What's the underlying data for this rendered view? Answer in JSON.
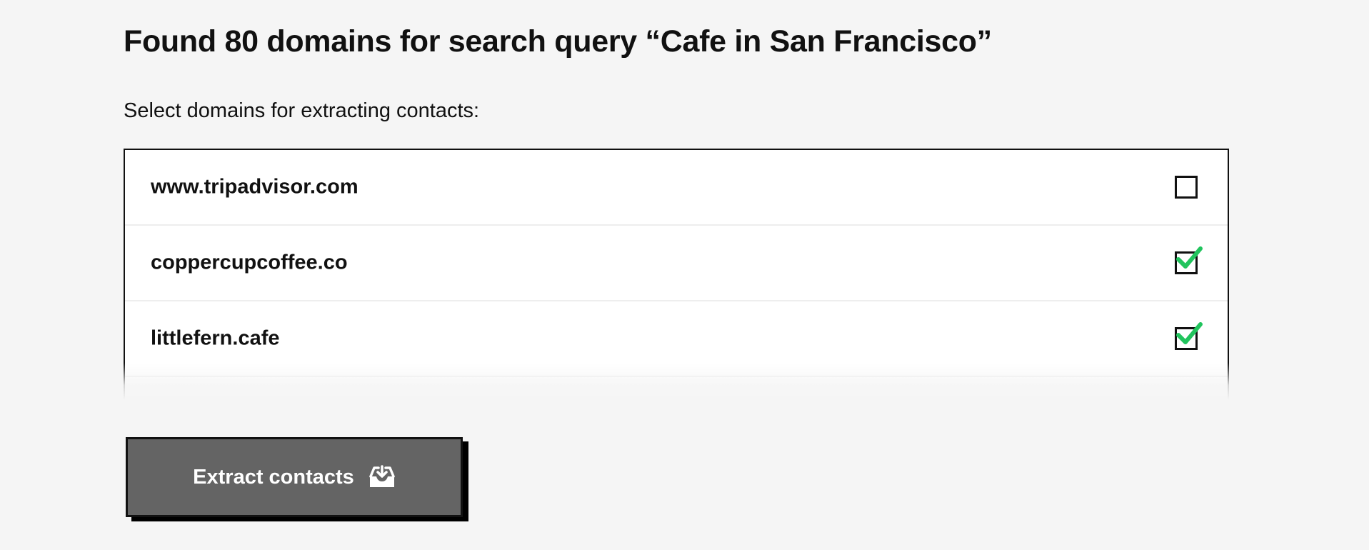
{
  "header": {
    "title": "Found 80 domains for search query “Cafe in San Francisco”",
    "subtitle": "Select domains for extracting contacts:"
  },
  "domains": [
    {
      "label": "www.tripadvisor.com",
      "checked": false
    },
    {
      "label": "coppercupcoffee.co",
      "checked": true
    },
    {
      "label": "littlefern.cafe",
      "checked": true
    }
  ],
  "actions": {
    "extract_label": "Extract contacts",
    "extract_icon": "inbox-download-icon"
  },
  "colors": {
    "background": "#f5f5f5",
    "button": "#646464",
    "check": "#21c45d",
    "border": "#111111"
  }
}
